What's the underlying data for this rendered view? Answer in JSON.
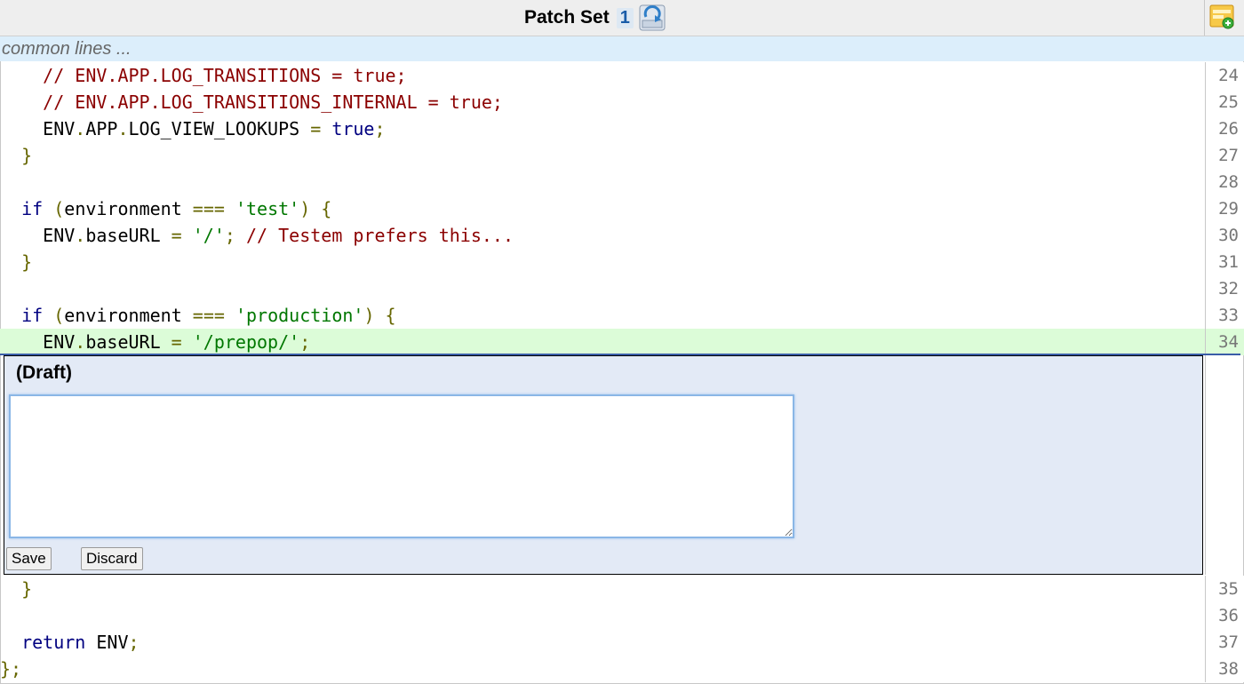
{
  "header": {
    "patch_set_label": "Patch Set",
    "patch_set_number": "1",
    "icons": [
      "refresh-icon",
      "expand-icon"
    ]
  },
  "common_lines": "common lines ...",
  "code_lines": [
    {
      "num": "24",
      "tokens": [
        [
          "    ",
          ""
        ],
        [
          "// ENV.APP.LOG_TRANSITIONS = true;",
          "com"
        ]
      ]
    },
    {
      "num": "25",
      "tokens": [
        [
          "    ",
          ""
        ],
        [
          "// ENV.APP.LOG_TRANSITIONS_INTERNAL = true;",
          "com"
        ]
      ]
    },
    {
      "num": "26",
      "tokens": [
        [
          "    ENV",
          ""
        ],
        [
          ".",
          "pun"
        ],
        [
          "APP",
          ""
        ],
        [
          ".",
          "pun"
        ],
        [
          "LOG_VIEW_LOOKUPS ",
          ""
        ],
        [
          "=",
          "pun"
        ],
        [
          " ",
          ""
        ],
        [
          "true",
          "kw"
        ],
        [
          ";",
          "pun"
        ]
      ]
    },
    {
      "num": "27",
      "tokens": [
        [
          "  ",
          ""
        ],
        [
          "}",
          "pun"
        ]
      ]
    },
    {
      "num": "28",
      "tokens": []
    },
    {
      "num": "29",
      "tokens": [
        [
          "  ",
          ""
        ],
        [
          "if",
          "kw"
        ],
        [
          " ",
          ""
        ],
        [
          "(",
          "pun"
        ],
        [
          "environment ",
          ""
        ],
        [
          "===",
          "pun"
        ],
        [
          " ",
          ""
        ],
        [
          "'test'",
          "str"
        ],
        [
          ")",
          "pun"
        ],
        [
          " ",
          ""
        ],
        [
          "{",
          "pun"
        ]
      ]
    },
    {
      "num": "30",
      "tokens": [
        [
          "    ENV",
          ""
        ],
        [
          ".",
          "pun"
        ],
        [
          "baseURL ",
          ""
        ],
        [
          "=",
          "pun"
        ],
        [
          " ",
          ""
        ],
        [
          "'/'",
          "str"
        ],
        [
          ";",
          "pun"
        ],
        [
          " ",
          ""
        ],
        [
          "// Testem prefers this...",
          "com"
        ]
      ]
    },
    {
      "num": "31",
      "tokens": [
        [
          "  ",
          ""
        ],
        [
          "}",
          "pun"
        ]
      ]
    },
    {
      "num": "32",
      "tokens": []
    },
    {
      "num": "33",
      "tokens": [
        [
          "  ",
          ""
        ],
        [
          "if",
          "kw"
        ],
        [
          " ",
          ""
        ],
        [
          "(",
          "pun"
        ],
        [
          "environment ",
          ""
        ],
        [
          "===",
          "pun"
        ],
        [
          " ",
          ""
        ],
        [
          "'production'",
          "str"
        ],
        [
          ")",
          "pun"
        ],
        [
          " ",
          ""
        ],
        [
          "{",
          "pun"
        ]
      ]
    },
    {
      "num": "34",
      "added": true,
      "tokens": [
        [
          "    ENV",
          ""
        ],
        [
          ".",
          "pun"
        ],
        [
          "baseURL ",
          ""
        ],
        [
          "=",
          "pun"
        ],
        [
          " ",
          ""
        ],
        [
          "'/prepop/'",
          "str"
        ],
        [
          ";",
          "pun"
        ]
      ]
    },
    {
      "num": "35",
      "tokens": [
        [
          "  ",
          ""
        ],
        [
          "}",
          "pun"
        ]
      ]
    },
    {
      "num": "36",
      "tokens": []
    },
    {
      "num": "37",
      "tokens": [
        [
          "  ",
          ""
        ],
        [
          "return",
          "kw"
        ],
        [
          " ENV",
          ""
        ],
        [
          ";",
          "pun"
        ]
      ]
    },
    {
      "num": "38",
      "tokens": [
        [
          "}",
          "pun"
        ],
        [
          ";",
          "pun"
        ]
      ]
    }
  ],
  "draft": {
    "title": "(Draft)",
    "text": "",
    "save_label": "Save",
    "discard_label": "Discard"
  },
  "colors": {
    "added_line": "#dcfcd8",
    "common_bar": "#dceefb",
    "draft_bg": "#e3eaf6",
    "comment": "#8b0000",
    "keyword": "#000080",
    "string": "#007700"
  }
}
